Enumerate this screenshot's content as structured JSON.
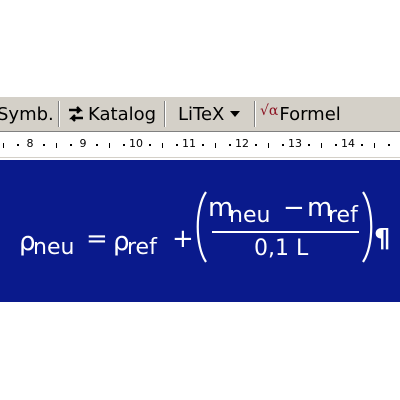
{
  "toolbar": {
    "symb_label": "Symb.",
    "katalog_label": "Katalog",
    "litex_label": "LiTeX",
    "formel_label": "Formel",
    "formel_icon_text": "√α"
  },
  "ruler": {
    "labels": [
      "8",
      "9",
      "10",
      "11",
      "12",
      "13",
      "14"
    ]
  },
  "formula": {
    "rho": "ρ",
    "sub_neu": "neu",
    "equals": "=",
    "sub_ref": "ref",
    "plus": "+",
    "m": "m",
    "minus": "−",
    "denominator": "0,1 L",
    "pilcrow": "¶"
  },
  "colors": {
    "toolbar_bg": "#d4d0c8",
    "document_bg": "#0a1a8c",
    "formula_text": "#ffffff"
  },
  "icons": {
    "katalog": "swap-arrows-icon",
    "litex": "dropdown-arrow-icon",
    "formel": "sqrt-alpha-icon"
  }
}
